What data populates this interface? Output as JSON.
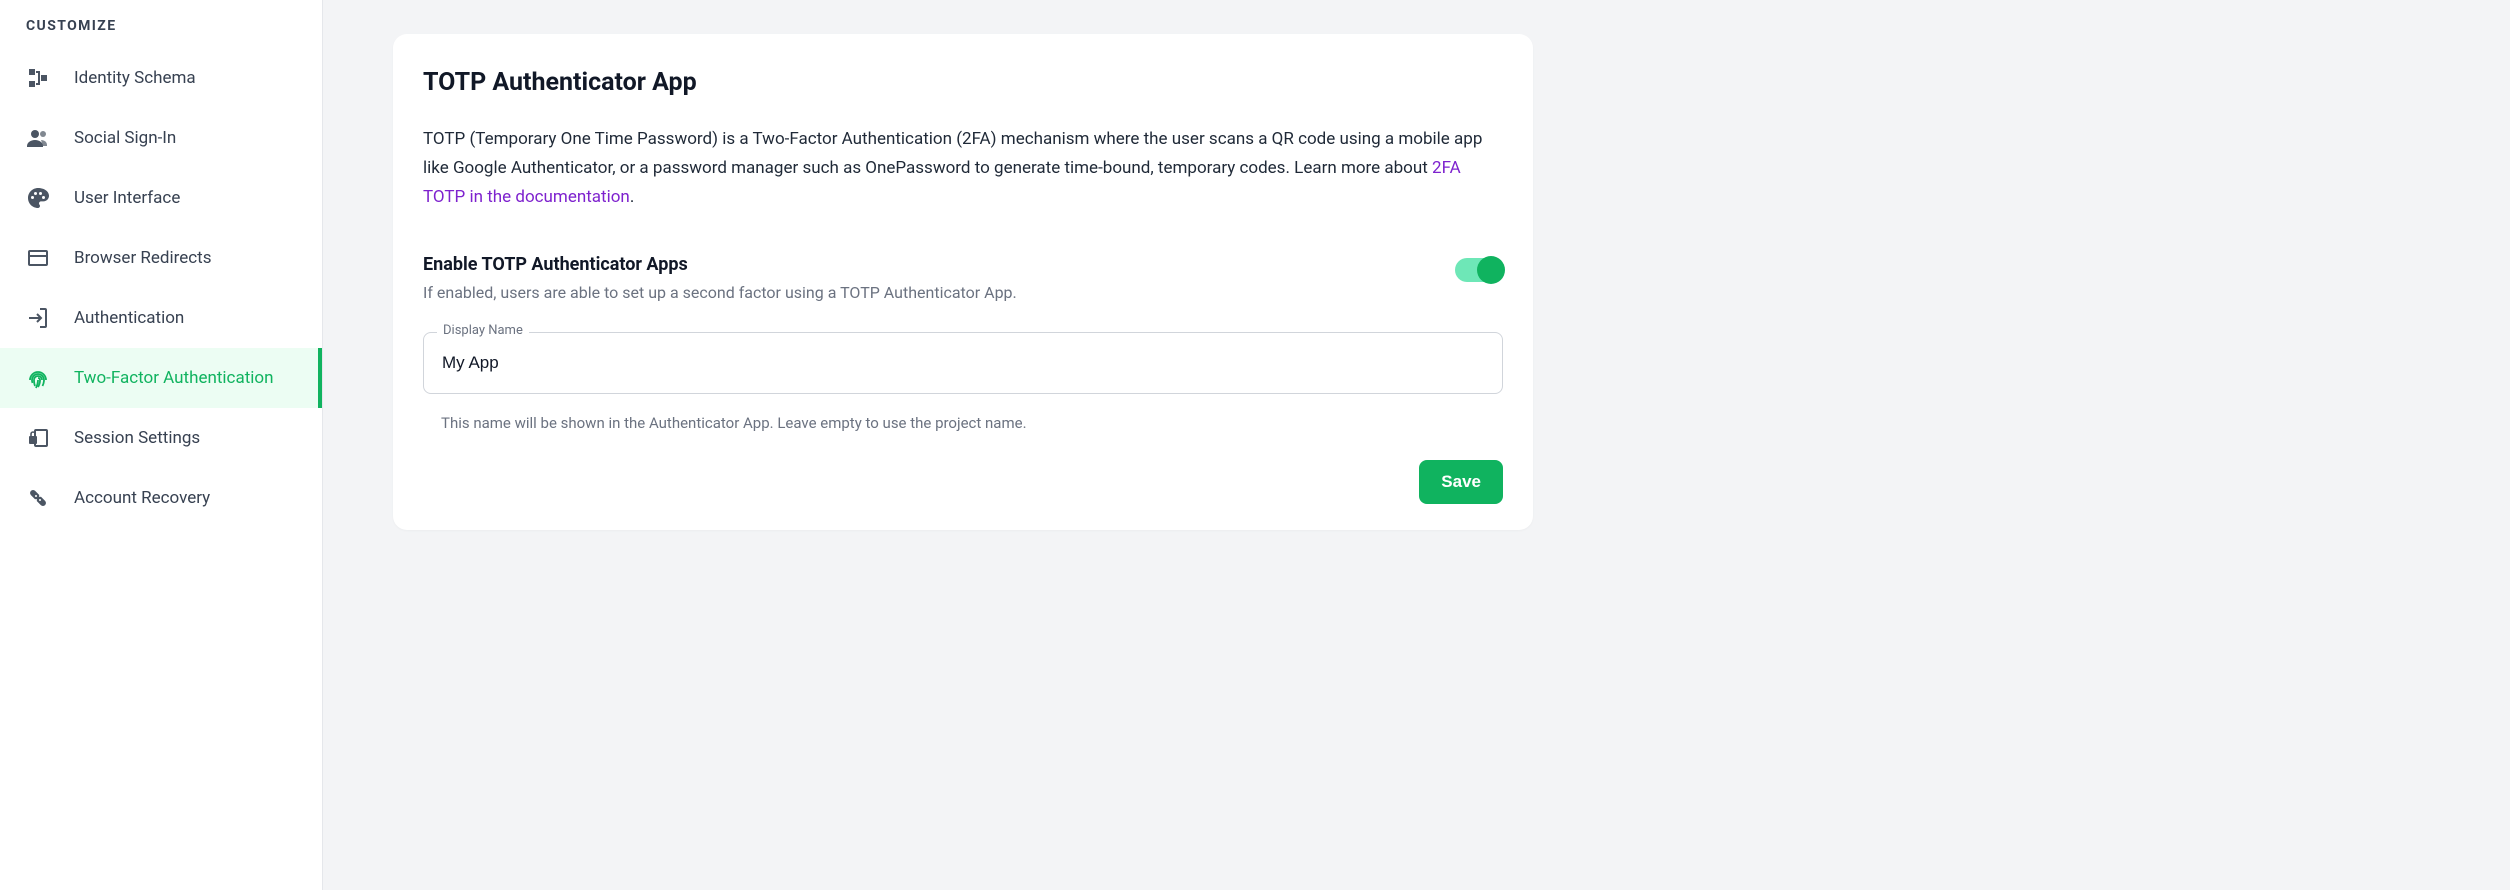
{
  "sidebar": {
    "header": "CUSTOMIZE",
    "items": [
      {
        "label": "Identity Schema"
      },
      {
        "label": "Social Sign-In"
      },
      {
        "label": "User Interface"
      },
      {
        "label": "Browser Redirects"
      },
      {
        "label": "Authentication"
      },
      {
        "label": "Two-Factor Authentication"
      },
      {
        "label": "Session Settings"
      },
      {
        "label": "Account Recovery"
      }
    ]
  },
  "card": {
    "title": "TOTP Authenticator App",
    "desc_prefix": "TOTP (Temporary One Time Password) is a Two-Factor Authentication (2FA) mechanism where the user scans a QR code using a mobile app like Google Authenticator, or a password manager such as OnePassword to generate time-bound, temporary codes. Learn more about ",
    "desc_link": "2FA TOTP in the documentation",
    "desc_suffix": ".",
    "toggle": {
      "title": "Enable TOTP Authenticator Apps",
      "subtitle": "If enabled, users are able to set up a second factor using a TOTP Authenticator App."
    },
    "field": {
      "label": "Display Name",
      "value": "My App",
      "help": "This name will be shown in the Authenticator App. Leave empty to use the project name."
    },
    "save_label": "Save"
  }
}
